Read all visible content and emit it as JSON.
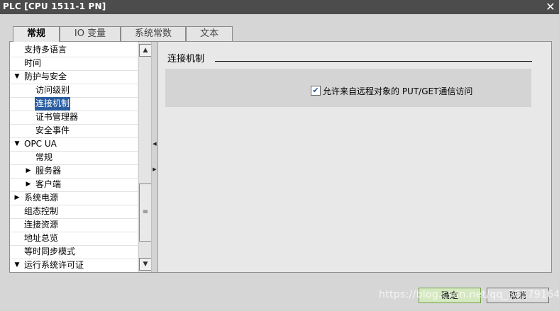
{
  "window": {
    "title": "PLC [CPU 1511-1 PN]",
    "close_glyph": "✕"
  },
  "tabs": [
    {
      "label": "常规",
      "active": true
    },
    {
      "label": "IO 变量",
      "active": false
    },
    {
      "label": "系统常数",
      "active": false
    },
    {
      "label": "文本",
      "active": false
    }
  ],
  "tree": {
    "items": [
      {
        "label": "支持多语言",
        "arrow": ""
      },
      {
        "label": "时间",
        "arrow": ""
      },
      {
        "label": "防护与安全",
        "arrow": "▼"
      },
      {
        "label": "访问级别",
        "arrow": ""
      },
      {
        "label": "连接机制",
        "arrow": "",
        "selected": true
      },
      {
        "label": "证书管理器",
        "arrow": ""
      },
      {
        "label": "安全事件",
        "arrow": ""
      },
      {
        "label": "OPC UA",
        "arrow": "▼"
      },
      {
        "label": "常规",
        "arrow": ""
      },
      {
        "label": "服务器",
        "arrow": "▶"
      },
      {
        "label": "客户端",
        "arrow": "▶"
      },
      {
        "label": "系统电源",
        "arrow": "▶"
      },
      {
        "label": "组态控制",
        "arrow": ""
      },
      {
        "label": "连接资源",
        "arrow": ""
      },
      {
        "label": "地址总览",
        "arrow": ""
      },
      {
        "label": "等时同步模式",
        "arrow": ""
      },
      {
        "label": "运行系统许可证",
        "arrow": "▼"
      }
    ]
  },
  "scrollbar": {
    "up": "▲",
    "down": "▼",
    "thumb": "≡"
  },
  "main": {
    "section_title": "连接机制",
    "checkbox": {
      "checked": true,
      "mark": "✔",
      "label": "允许来自远程对象的 PUT/GET通信访问"
    }
  },
  "buttons": {
    "ok": "确定",
    "cancel": "取消"
  },
  "watermark": "https://blog.csdn.net/qq_38379164"
}
